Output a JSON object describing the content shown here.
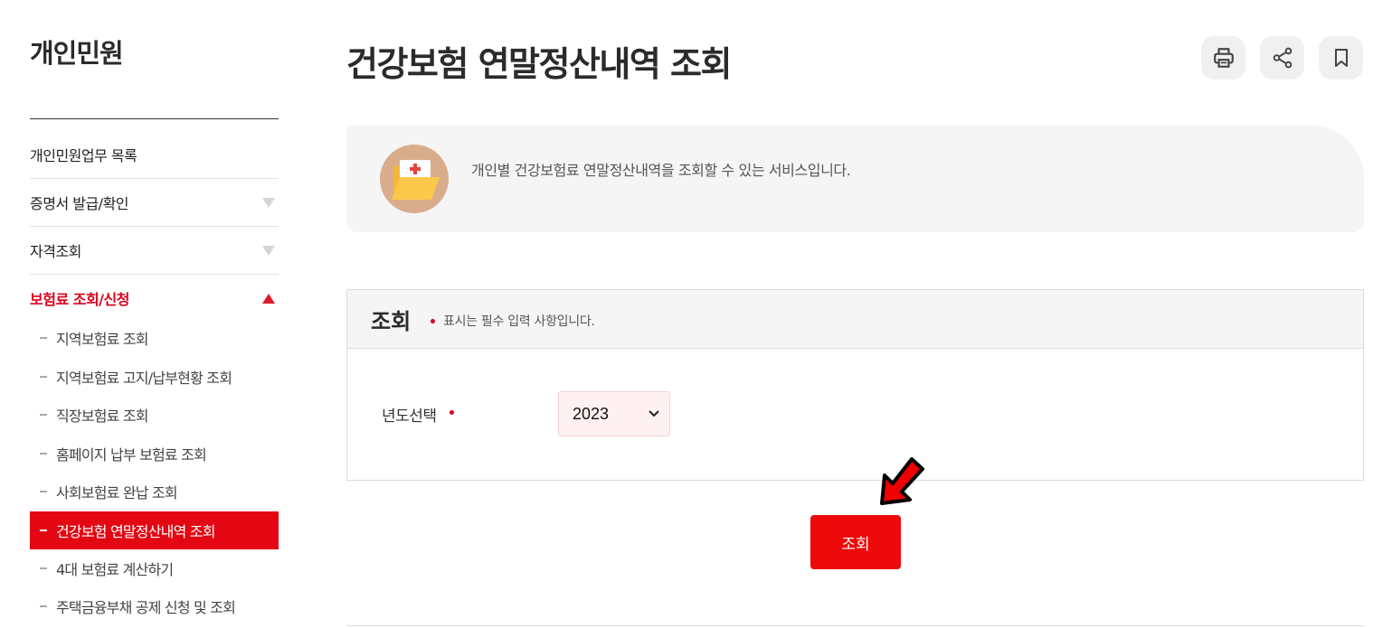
{
  "sidebar": {
    "title": "개인민원",
    "menu": [
      {
        "label": "개인민원업무 목록"
      },
      {
        "label": "증명서 발급/확인"
      },
      {
        "label": "자격조회"
      },
      {
        "label": "보험료 조회/신청"
      }
    ],
    "submenu": [
      {
        "label": "지역보험료 조회"
      },
      {
        "label": "지역보험료 고지/납부현황 조회"
      },
      {
        "label": "직장보험료 조회"
      },
      {
        "label": "홈페이지 납부 보험료 조회"
      },
      {
        "label": "사회보험료 완납 조회"
      },
      {
        "label": "건강보험 연말정산내역 조회"
      },
      {
        "label": "4대 보험료 계산하기"
      },
      {
        "label": "주택금융부채 공제 신청 및 조회"
      }
    ]
  },
  "page": {
    "title": "건강보험 연말정산내역 조회",
    "toolbar": {
      "print": "print-icon",
      "share": "share-icon",
      "bookmark": "bookmark-icon"
    }
  },
  "intro": {
    "text": "개인별 건강보험료 연말정산내역을 조회할 수 있는 서비스입니다.",
    "icon": "medical-folder-icon"
  },
  "form": {
    "title": "조회",
    "required_note": "표시는 필수 입력 사항입니다.",
    "year_label": "년도선택",
    "year_value": "2023",
    "submit_label": "조회"
  },
  "colors": {
    "accent": "#e30613",
    "active_text": "#d9001b",
    "panel_bg": "#f5f5f5",
    "select_bg": "#fff1f1"
  }
}
